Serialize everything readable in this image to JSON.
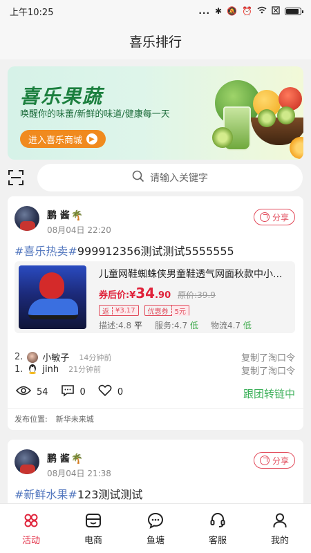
{
  "status_bar": {
    "time": "上午10:25",
    "dots": "..."
  },
  "header": {
    "title": "喜乐排行"
  },
  "banner": {
    "title": "喜乐果蔬",
    "subtitle": "唤醒你的味蕾/新鲜的味道/健康每一天",
    "button_label": "进入喜乐商城"
  },
  "search": {
    "placeholder": "请输入关键字"
  },
  "posts": [
    {
      "author": "鹏 酱",
      "author_emoji": "🌴",
      "time": "08月04日 22:20",
      "share_label": "分享",
      "hashtag": "#喜乐热卖#",
      "text": "999912356测试测试5555555",
      "product": {
        "title": "儿童网鞋蜘蛛侠男童鞋透气网面秋款中小...",
        "price_label": "券后价:",
        "currency": "¥",
        "price_int": "34",
        "price_dec": ".90",
        "orig_price": "原价:39.9",
        "rebate_label": "返",
        "rebate_value": "¥3.17",
        "coupon_label": "优惠券",
        "coupon_value": "5元",
        "desc_label": "描述:4.8",
        "desc_level": "平",
        "service_label": "服务:4.7",
        "service_level": "低",
        "logistics_label": "物流4.7",
        "logistics_level": "低"
      },
      "copies": [
        {
          "rank": "2.",
          "name": "小敏子",
          "ago": "14分钟前",
          "action": "复制了淘口令"
        },
        {
          "rank": "1.",
          "name": "jinh",
          "ago": "21分钟前",
          "action": "复制了淘口令"
        }
      ],
      "views": "54",
      "comments": "0",
      "likes": "0",
      "follow_label": "跟团转链中",
      "location_label": "发布位置:",
      "location": "新华未来城"
    },
    {
      "author": "鹏 酱",
      "author_emoji": "🌴",
      "time": "08月04日 21:38",
      "share_label": "分享",
      "hashtag": "#新鲜水果#",
      "text": "123测试测试"
    }
  ],
  "nav": [
    {
      "label": "活动"
    },
    {
      "label": "电商"
    },
    {
      "label": "鱼塘"
    },
    {
      "label": "客服"
    },
    {
      "label": "我的"
    }
  ],
  "colors": {
    "accent": "#e0223a",
    "hashtag": "#5478bf",
    "success": "#3db05a",
    "banner_green": "#1b7f3e",
    "banner_button": "#f08a1e"
  }
}
